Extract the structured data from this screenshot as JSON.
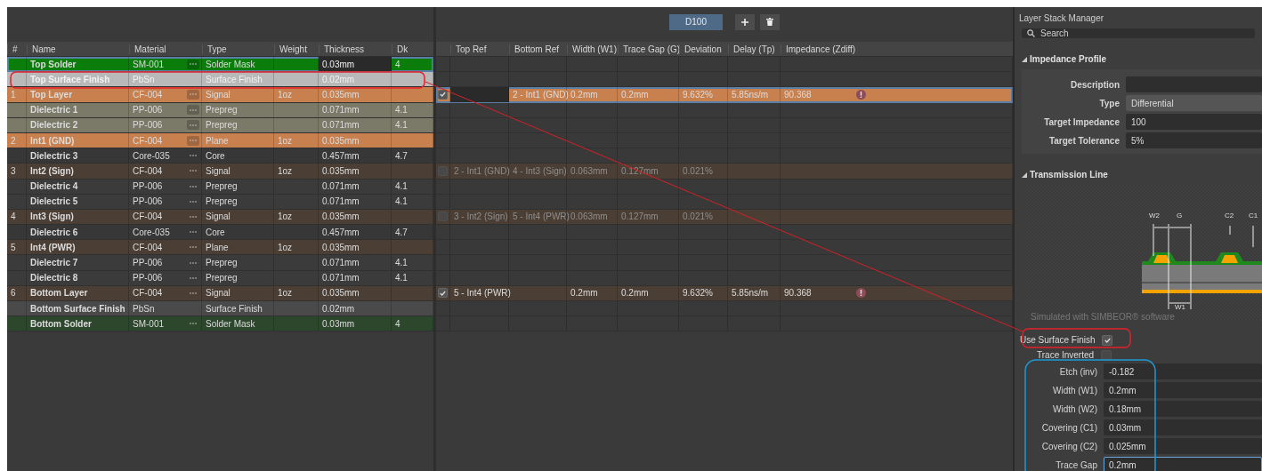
{
  "toolbar": {
    "tabs": [
      {
        "label": "D100",
        "selected": true
      }
    ]
  },
  "stack_table": {
    "columns": [
      "#",
      "Name",
      "Material",
      "Type",
      "Weight",
      "Thickness",
      "Dk"
    ],
    "rows": [
      {
        "kind": "solder_mask",
        "highlighted": true,
        "selected": true,
        "thickness_editing": true,
        "name": "Top Solder",
        "material": "SM-001",
        "material_button": true,
        "type": "Solder Mask",
        "thickness": "0.03mm",
        "dk": "4"
      },
      {
        "kind": "surface_finish",
        "highlighted": true,
        "selected": false,
        "name": "Top Surface Finish",
        "material": "PbSn",
        "material_button": false,
        "type": "Surface Finish",
        "thickness": "0.02mm"
      },
      {
        "kind": "signal",
        "highlighted": true,
        "selected": false,
        "num": "1",
        "name": "Top Layer",
        "material": "CF-004",
        "material_button": true,
        "type": "Signal",
        "weight": "1oz",
        "thickness": "0.035mm"
      },
      {
        "kind": "prepreg",
        "highlighted": true,
        "selected": false,
        "name": "Dielectric 1",
        "material": "PP-006",
        "material_button": true,
        "type": "Prepreg",
        "thickness": "0.071mm",
        "dk": "4.1"
      },
      {
        "kind": "prepreg",
        "highlighted": true,
        "selected": false,
        "name": "Dielectric 2",
        "material": "PP-006",
        "material_button": true,
        "type": "Prepreg",
        "thickness": "0.071mm",
        "dk": "4.1"
      },
      {
        "kind": "plane",
        "highlighted": true,
        "selected": false,
        "num": "2",
        "name": "Int1 (GND)",
        "material": "CF-004",
        "material_button": true,
        "type": "Plane",
        "weight": "1oz",
        "thickness": "0.035mm"
      },
      {
        "kind": "core",
        "highlighted": false,
        "selected": false,
        "name": "Dielectric 3",
        "material": "Core-035",
        "material_button": true,
        "type": "Core",
        "thickness": "0.457mm",
        "dk": "4.7"
      },
      {
        "kind": "signal",
        "highlighted": false,
        "selected": false,
        "num": "3",
        "name": "Int2 (Sign)",
        "material": "CF-004",
        "material_button": true,
        "type": "Signal",
        "weight": "1oz",
        "thickness": "0.035mm"
      },
      {
        "kind": "prepreg",
        "highlighted": false,
        "selected": false,
        "name": "Dielectric 4",
        "material": "PP-006",
        "material_button": true,
        "type": "Prepreg",
        "thickness": "0.071mm",
        "dk": "4.1"
      },
      {
        "kind": "prepreg",
        "highlighted": false,
        "selected": false,
        "name": "Dielectric 5",
        "material": "PP-006",
        "material_button": true,
        "type": "Prepreg",
        "thickness": "0.071mm",
        "dk": "4.1"
      },
      {
        "kind": "signal",
        "highlighted": false,
        "selected": false,
        "num": "4",
        "name": "Int3 (Sign)",
        "material": "CF-004",
        "material_button": true,
        "type": "Signal",
        "weight": "1oz",
        "thickness": "0.035mm"
      },
      {
        "kind": "core",
        "highlighted": false,
        "selected": false,
        "name": "Dielectric 6",
        "material": "Core-035",
        "material_button": true,
        "type": "Core",
        "thickness": "0.457mm",
        "dk": "4.7"
      },
      {
        "kind": "plane",
        "highlighted": false,
        "selected": false,
        "num": "5",
        "name": "Int4 (PWR)",
        "material": "CF-004",
        "material_button": true,
        "type": "Plane",
        "weight": "1oz",
        "thickness": "0.035mm"
      },
      {
        "kind": "prepreg",
        "highlighted": false,
        "selected": false,
        "name": "Dielectric 7",
        "material": "PP-006",
        "material_button": true,
        "type": "Prepreg",
        "thickness": "0.071mm",
        "dk": "4.1"
      },
      {
        "kind": "prepreg",
        "highlighted": false,
        "selected": false,
        "name": "Dielectric 8",
        "material": "PP-006",
        "material_button": true,
        "type": "Prepreg",
        "thickness": "0.071mm",
        "dk": "4.1"
      },
      {
        "kind": "signal",
        "highlighted": false,
        "selected": false,
        "num": "6",
        "name": "Bottom Layer",
        "material": "CF-004",
        "material_button": true,
        "type": "Signal",
        "weight": "1oz",
        "thickness": "0.035mm"
      },
      {
        "kind": "surface_finish",
        "highlighted": false,
        "selected": false,
        "name": "Bottom Surface Finish",
        "material": "PbSn",
        "material_button": false,
        "type": "Surface Finish",
        "thickness": "0.02mm"
      },
      {
        "kind": "solder_mask",
        "highlighted": false,
        "selected": false,
        "name": "Bottom Solder",
        "material": "SM-001",
        "material_button": true,
        "type": "Solder Mask",
        "thickness": "0.03mm",
        "dk": "4"
      }
    ]
  },
  "impedance_table": {
    "columns": [
      "Top Ref",
      "Bottom Ref",
      "Width (W1)",
      "Trace Gap (G)",
      "Deviation",
      "Delay (Tp)",
      "Impedance (Zdiff)"
    ],
    "rows": [
      {
        "kind": "empty"
      },
      {
        "kind": "empty"
      },
      {
        "kind": "pair",
        "checked": true,
        "selected": true,
        "disabled": false,
        "top_ref_editing": true,
        "bottom_ref": "2 - Int1 (GND)",
        "width": "0.2mm",
        "trace_gap": "0.2mm",
        "deviation": "9.632%",
        "delay": "5.85ns/m",
        "impedance": "90.368",
        "warning": true
      },
      {
        "kind": "empty"
      },
      {
        "kind": "empty"
      },
      {
        "kind": "empty"
      },
      {
        "kind": "empty"
      },
      {
        "kind": "pair",
        "checked": false,
        "selected": false,
        "disabled": true,
        "top_ref": "2 - Int1 (GND)",
        "bottom_ref": "4 - Int3 (Sign)",
        "width": "0.063mm",
        "trace_gap": "0.127mm",
        "deviation": "0.021%",
        "warning": false
      },
      {
        "kind": "empty"
      },
      {
        "kind": "empty"
      },
      {
        "kind": "pair",
        "checked": false,
        "selected": false,
        "disabled": true,
        "top_ref": "3 - Int2 (Sign)",
        "bottom_ref": "5 - Int4 (PWR)",
        "width": "0.063mm",
        "trace_gap": "0.127mm",
        "deviation": "0.021%",
        "warning": false
      },
      {
        "kind": "empty"
      },
      {
        "kind": "empty"
      },
      {
        "kind": "empty"
      },
      {
        "kind": "empty"
      },
      {
        "kind": "pair",
        "checked": true,
        "selected": false,
        "disabled": false,
        "top_ref": "5 - Int4 (PWR)",
        "width": "0.2mm",
        "trace_gap": "0.2mm",
        "deviation": "9.632%",
        "delay": "5.85ns/m",
        "impedance": "90.368",
        "warning": true
      },
      {
        "kind": "empty"
      },
      {
        "kind": "empty"
      }
    ]
  },
  "panel": {
    "title": "Layer Stack Manager",
    "search": {
      "placeholder": "Search"
    },
    "sections": [
      {
        "title": "Impedance Profile",
        "expanded": true,
        "fields": [
          {
            "label": "Description",
            "kind": "text"
          },
          {
            "label": "Type",
            "value": "Differential",
            "kind": "dropdown"
          },
          {
            "label": "Target Impedance",
            "value": "100",
            "kind": "text"
          },
          {
            "label": "Target Tolerance",
            "value": "5%",
            "kind": "text"
          }
        ]
      },
      {
        "title": "Transmission Line",
        "expanded": true
      }
    ],
    "diagram": {
      "labels": [
        "W2",
        "G",
        "C2",
        "C1",
        "W1"
      ],
      "caption": "Simulated with SIMBEOR® software"
    },
    "options": [
      {
        "label": "Use Surface Finish",
        "checked": true
      },
      {
        "label": "Trace Inverted",
        "checked": false
      }
    ],
    "fields": [
      {
        "label": "Etch (inv)",
        "value": "-0.182",
        "focused": false
      },
      {
        "label": "Width (W1)",
        "value": "0.2mm",
        "focused": false
      },
      {
        "label": "Width (W2)",
        "value": "0.18mm",
        "focused": false
      },
      {
        "label": "Covering (C1)",
        "value": "0.03mm",
        "focused": false
      },
      {
        "label": "Covering (C2)",
        "value": "0.025mm",
        "focused": false
      },
      {
        "label": "Trace Gap",
        "value": "0.2mm",
        "focused": true
      }
    ]
  }
}
